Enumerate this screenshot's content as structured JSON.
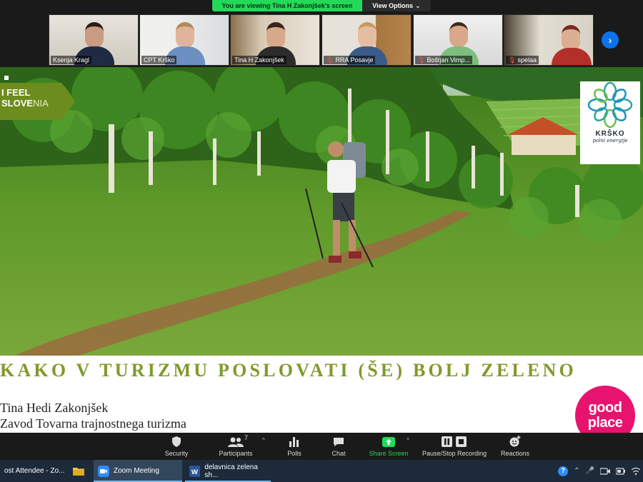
{
  "banner": {
    "message": "You are viewing Tina H Zakonjšek's screen",
    "view_options": "View Options"
  },
  "participants": [
    {
      "name": "Ksenja Kragl",
      "muted": false
    },
    {
      "name": "CPT Krško",
      "muted": false
    },
    {
      "name": "Tina H Zakonjšek",
      "muted": false
    },
    {
      "name": "RRA Posavje",
      "muted": true
    },
    {
      "name": "Boštjan Vimp...",
      "muted": true
    },
    {
      "name": "spelaa",
      "muted": true
    }
  ],
  "slide": {
    "badge_line1": "I FEEL",
    "badge_line2_bold": "SLOVE",
    "badge_line2_light": "NIA",
    "krsko_name": "KRŠKO",
    "krsko_tagline": "polni energije",
    "title": "KAKO V TURIZMU POSLOVATI (ŠE) BOLJ ZELENO",
    "author": "Tina Hedi Zakonjšek",
    "organization": "Zavod Tovarna trajnostnega turizma",
    "logo_line1": "good",
    "logo_line2": "place"
  },
  "toolbar": {
    "security": "Security",
    "participants": "Participants",
    "participant_count": "7",
    "polls": "Polls",
    "chat": "Chat",
    "share_screen": "Share Screen",
    "recording": "Pause/Stop Recording",
    "reactions": "Reactions"
  },
  "taskbar": {
    "task1": "ost Attendee - Zo...",
    "task2": "Zoom Meeting",
    "task3": "delavnica zelena sh..."
  },
  "colors": {
    "zoom_green": "#23d959",
    "slide_green": "#7f9a2a",
    "goodplace_pink": "#e8136e"
  }
}
